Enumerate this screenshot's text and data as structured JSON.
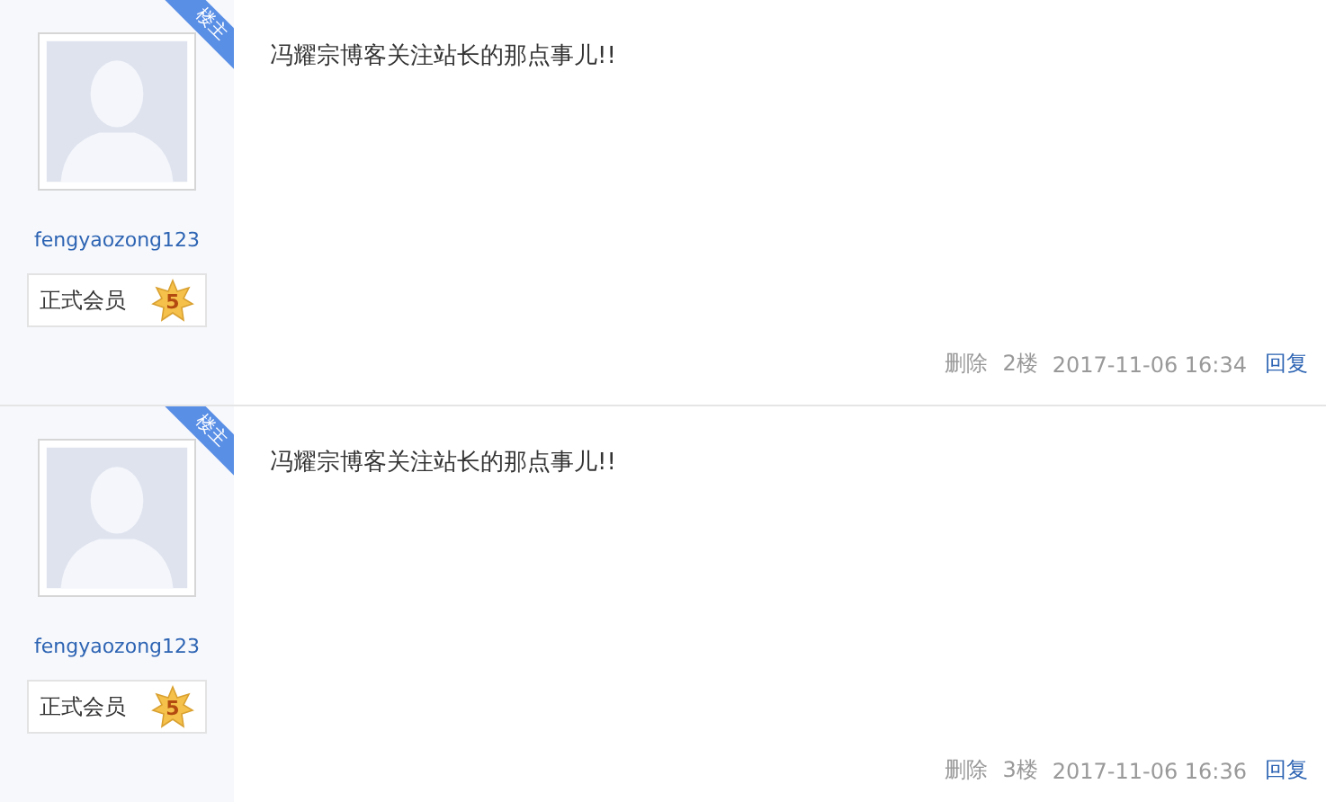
{
  "posts": [
    {
      "author": {
        "name": "fengyaozong123",
        "rank": "正式会员",
        "level": "5",
        "badge": "楼主"
      },
      "content": "冯耀宗博客关注站长的那点事儿!!",
      "actions": {
        "delete": "删除",
        "floor": "2楼",
        "time": "2017-11-06 16:34",
        "reply": "回复"
      }
    },
    {
      "author": {
        "name": "fengyaozong123",
        "rank": "正式会员",
        "level": "5",
        "badge": "楼主"
      },
      "content": "冯耀宗博客关注站长的那点事儿!!",
      "actions": {
        "delete": "删除",
        "floor": "3楼",
        "time": "2017-11-06 16:36",
        "reply": "回复"
      }
    }
  ]
}
